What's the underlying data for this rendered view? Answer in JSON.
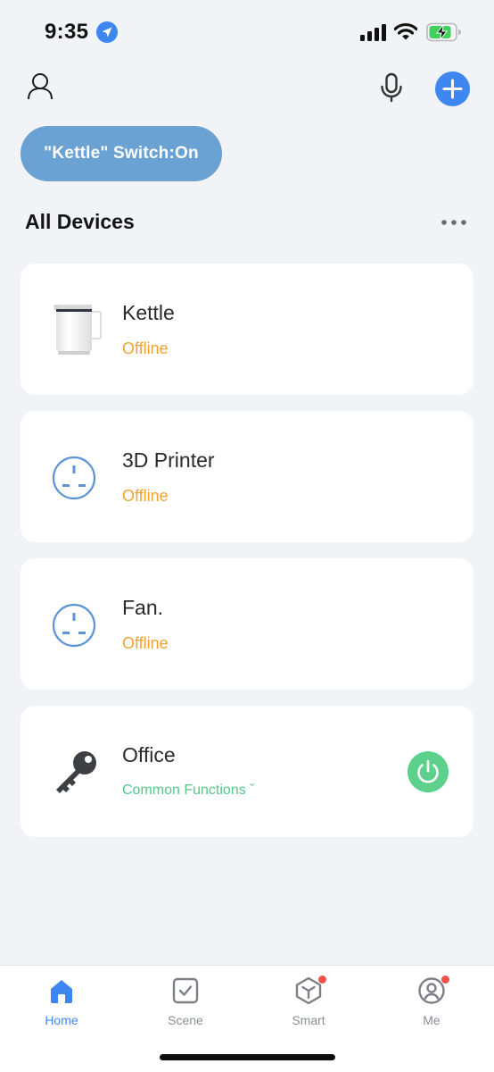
{
  "status_bar": {
    "time": "9:35"
  },
  "banner": {
    "text": "\"Kettle\" Switch:On"
  },
  "section": {
    "title": "All Devices"
  },
  "devices": [
    {
      "name": "Kettle",
      "status": "Offline",
      "icon": "kettle-icon"
    },
    {
      "name": "3D Printer",
      "status": "Offline",
      "icon": "socket-icon"
    },
    {
      "name": "Fan.",
      "status": "Offline",
      "icon": "socket-icon"
    },
    {
      "name": "Office",
      "status": "Common Functions ˇ",
      "icon": "key-icon",
      "power": true
    }
  ],
  "tabs": [
    {
      "label": "Home",
      "active": true
    },
    {
      "label": "Scene"
    },
    {
      "label": "Smart",
      "badge": true
    },
    {
      "label": "Me",
      "badge": true
    }
  ],
  "colors": {
    "accent": "#3f87f0",
    "offline": "#f0a234",
    "online": "#5dd08b",
    "banner": "#6aa2d4"
  }
}
